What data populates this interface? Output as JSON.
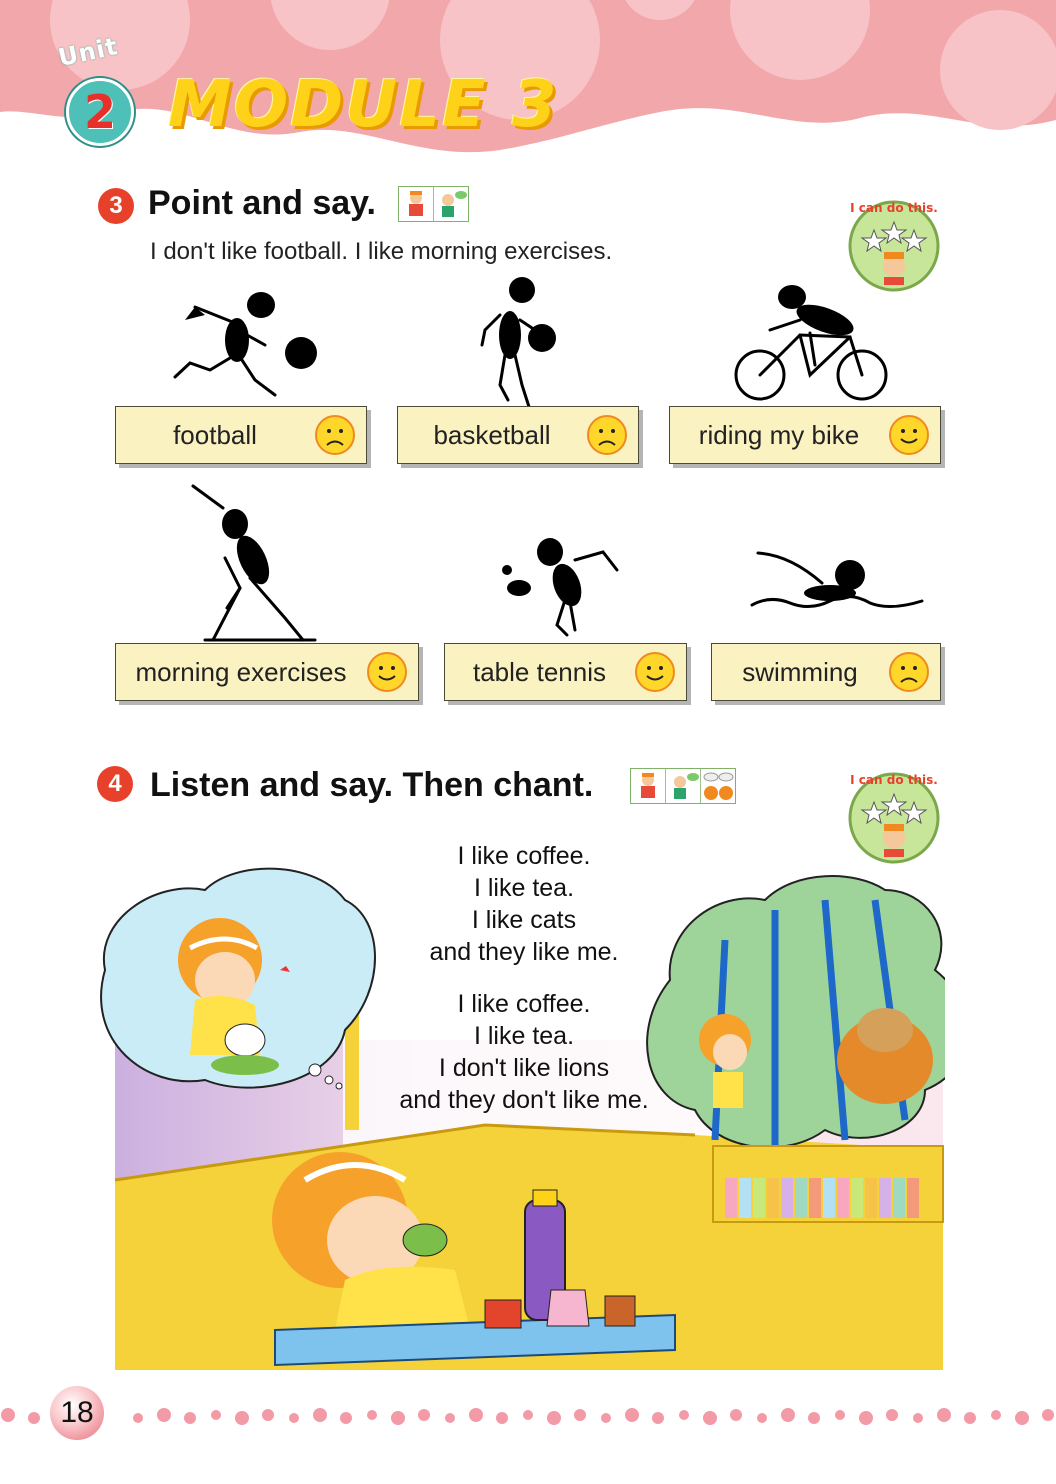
{
  "header": {
    "unit_word": "Unit",
    "unit_number": "2",
    "module_title": "MODULE 3",
    "colors": {
      "band": "#f2a7ab",
      "dot": "#fbd5d7",
      "title_fill": "#ffd21a"
    }
  },
  "section3": {
    "number": "3",
    "title": "Point and say.",
    "example": "I don't like football. I like morning exercises.",
    "badge_text": "I can do this.",
    "items": [
      {
        "label": "football",
        "face": "sad"
      },
      {
        "label": "basketball",
        "face": "sad"
      },
      {
        "label": "riding my bike",
        "face": "happy"
      },
      {
        "label": "morning exercises",
        "face": "happy"
      },
      {
        "label": "table tennis",
        "face": "happy"
      },
      {
        "label": "swimming",
        "face": "sad"
      }
    ]
  },
  "section4": {
    "number": "4",
    "title": "Listen and say. Then chant.",
    "badge_text": "I can do this.",
    "chant_verse1": [
      "I like coffee.",
      "I like tea.",
      "I like cats",
      "and they like me."
    ],
    "chant_verse2": [
      "I like coffee.",
      "I like tea.",
      "I don't like lions",
      "and they don't like me."
    ]
  },
  "footer": {
    "page_number": "18",
    "dot_color": "#f08a98"
  }
}
